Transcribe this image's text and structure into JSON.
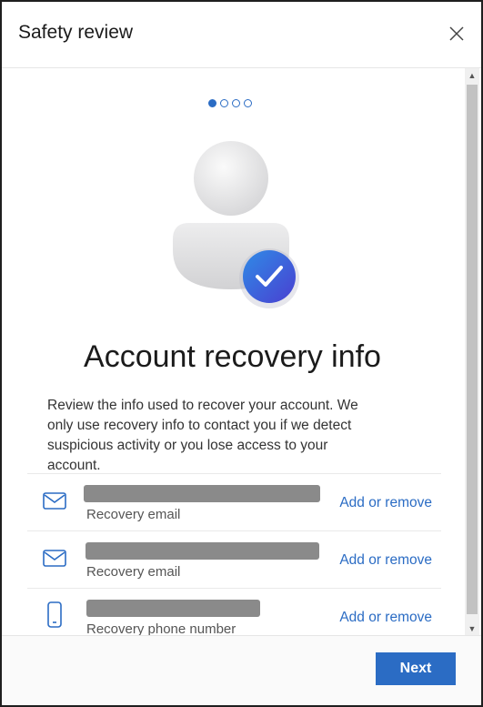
{
  "header": {
    "title": "Safety review",
    "close_icon": "close-icon"
  },
  "progress": {
    "total_steps": 4,
    "current_step": 1
  },
  "main": {
    "heading": "Account recovery info",
    "description": "Review the info used to recover your account. We only use recovery info to contact you if we detect suspicious activity or you lose access to your account.",
    "items": [
      {
        "icon": "mail-icon",
        "label": "Recovery email",
        "action": "Add or remove"
      },
      {
        "icon": "mail-icon",
        "label": "Recovery email",
        "action": "Add or remove"
      },
      {
        "icon": "phone-icon",
        "label": "Recovery phone number",
        "action": "Add or remove"
      }
    ]
  },
  "footer": {
    "next_label": "Next"
  },
  "colors": {
    "accent": "#2b6cc4",
    "redaction": "#8a8a8a"
  }
}
